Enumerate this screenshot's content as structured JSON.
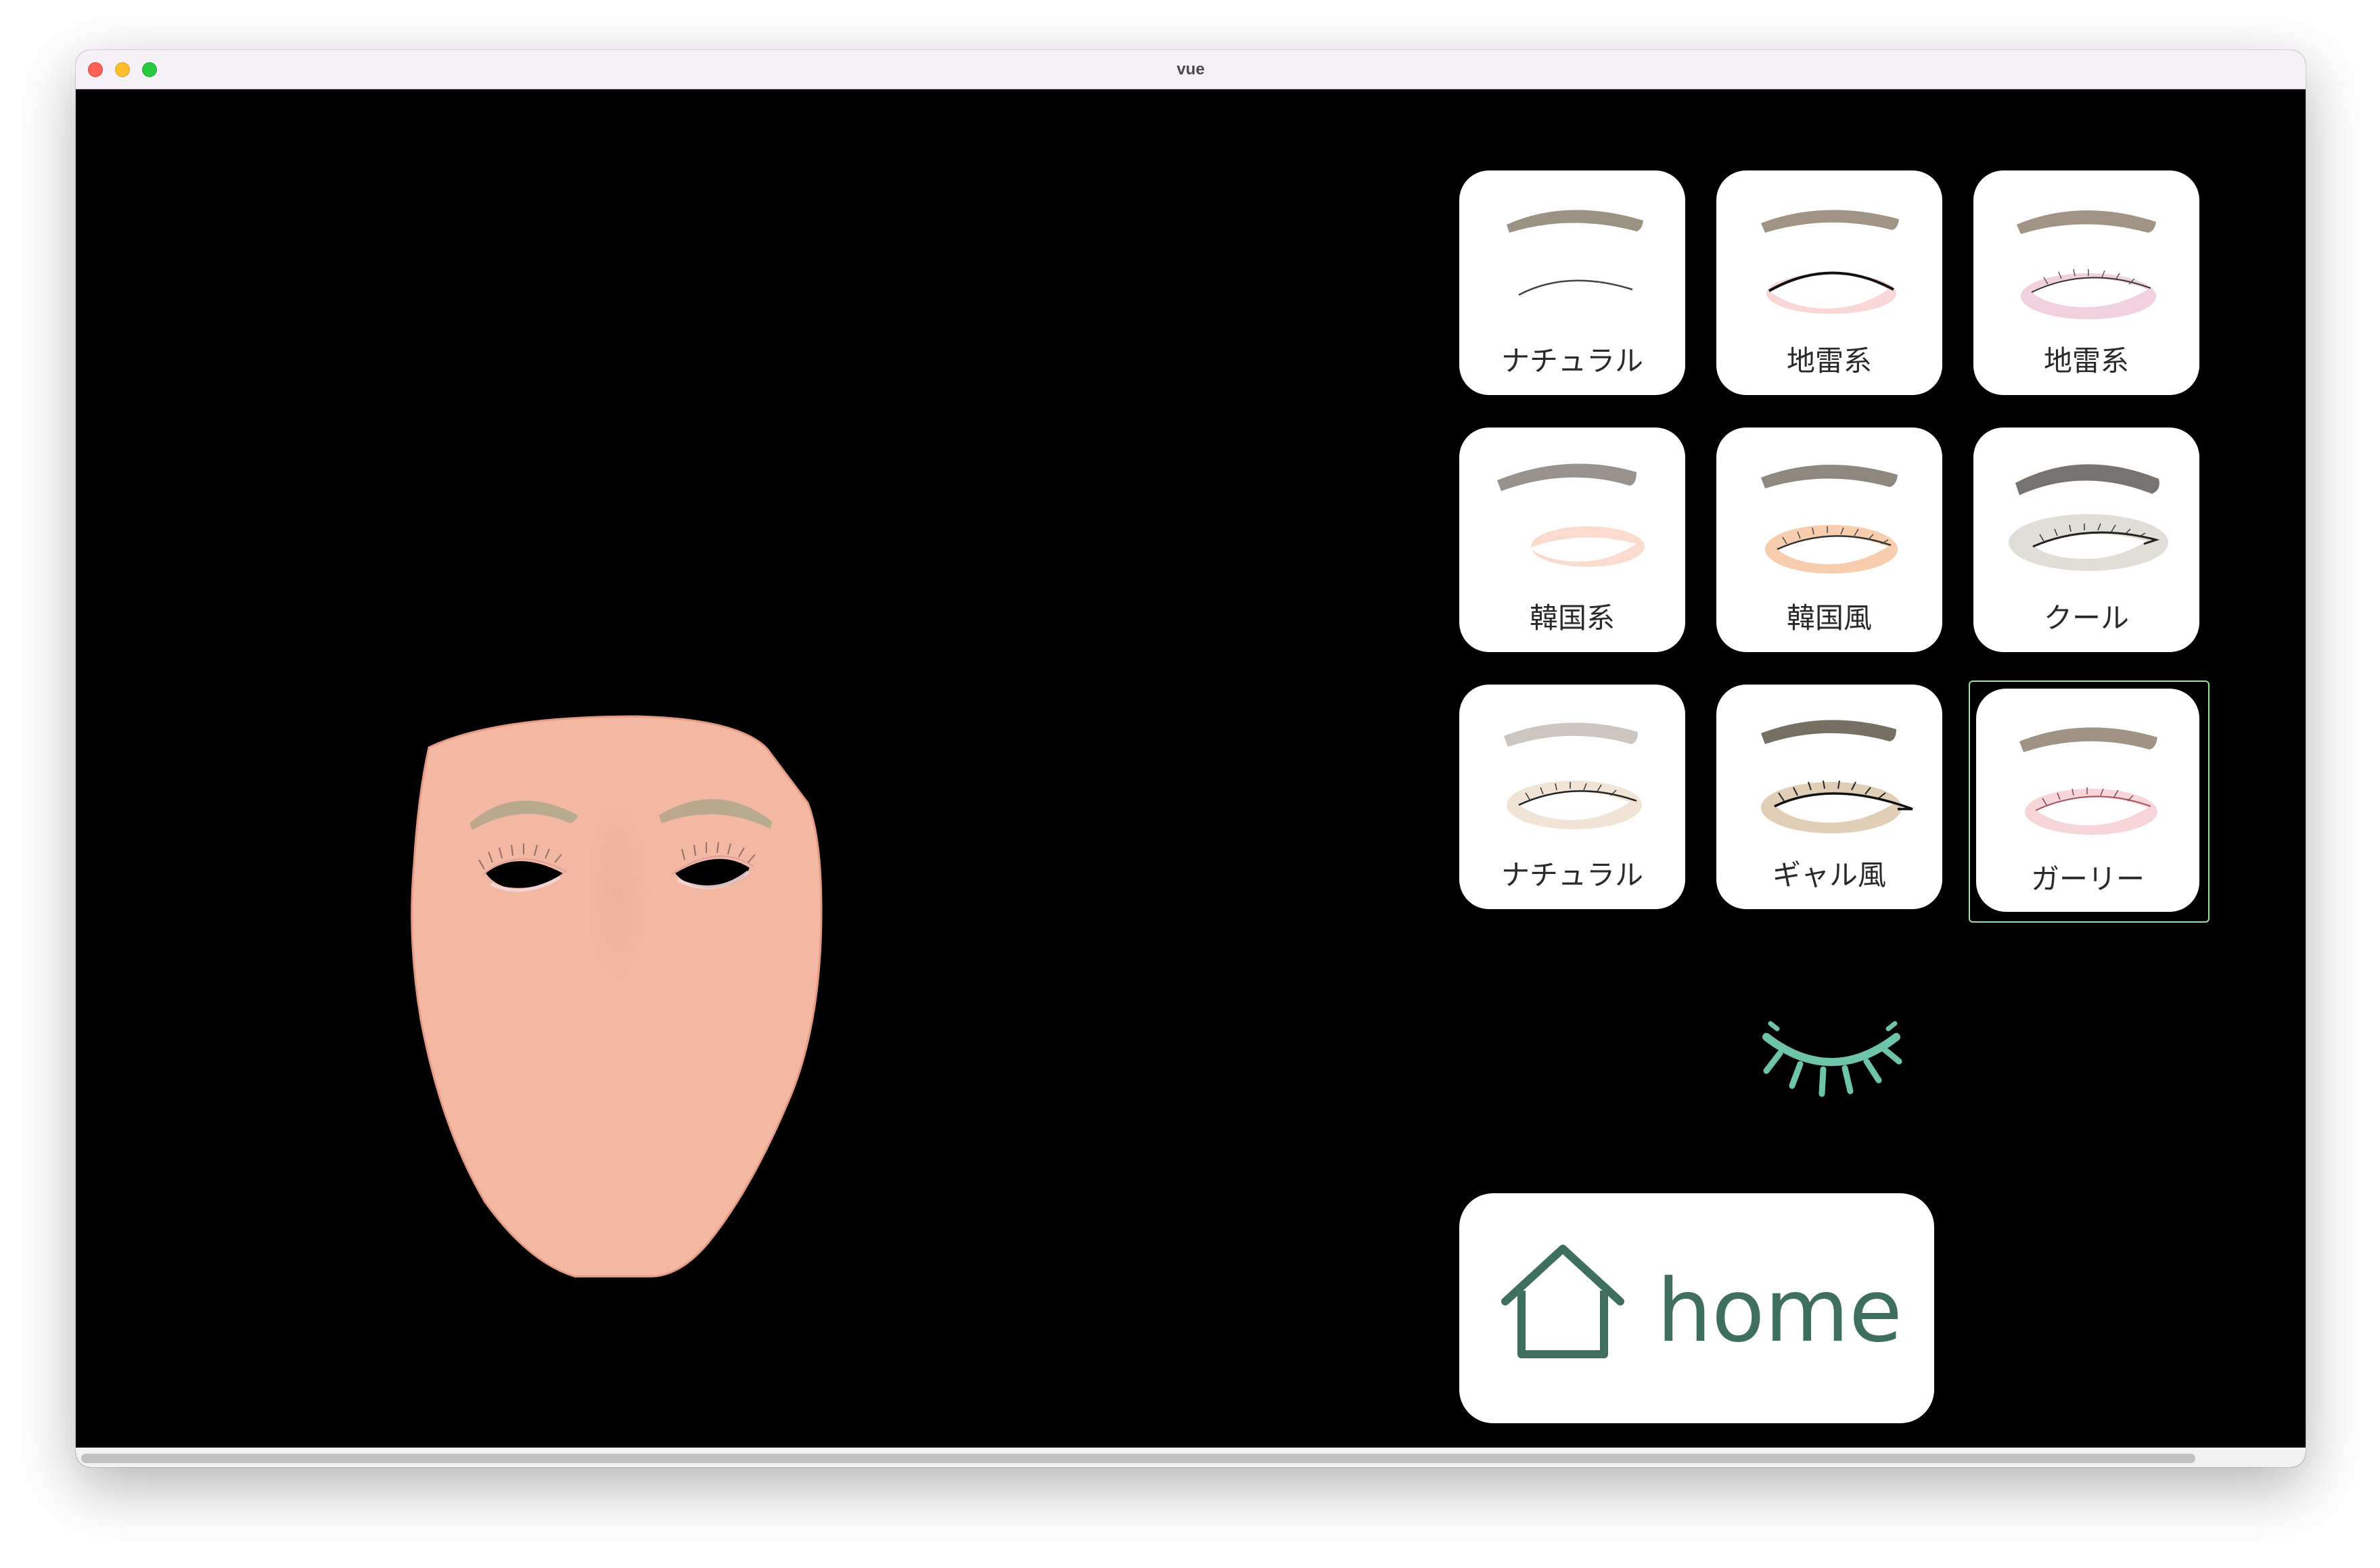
{
  "window": {
    "title": "vue"
  },
  "colors": {
    "accent": "#3e6e5e",
    "lash_icon": "#6fc3a8",
    "skin": "#f2b8a3",
    "selected_outline": "#9be39b",
    "background": "#000000"
  },
  "makeup_styles": [
    {
      "label": "ナチュラル",
      "icon": "eye-natural-icon"
    },
    {
      "label": "地雷系",
      "icon": "eye-jirai-icon"
    },
    {
      "label": "地雷系",
      "icon": "eye-jirai-pink-icon"
    },
    {
      "label": "韓国系",
      "icon": "eye-korean-icon"
    },
    {
      "label": "韓国風",
      "icon": "eye-korean-orange-icon"
    },
    {
      "label": "クール",
      "icon": "eye-cool-icon"
    },
    {
      "label": "ナチュラル",
      "icon": "eye-natural-lash-icon"
    },
    {
      "label": "ギャル風",
      "icon": "eye-gal-icon"
    },
    {
      "label": "ガーリー",
      "icon": "eye-girly-icon",
      "selected": true
    }
  ],
  "category_icon": "eyelash-icon",
  "home_button": {
    "label": "home",
    "icon": "house-icon"
  }
}
